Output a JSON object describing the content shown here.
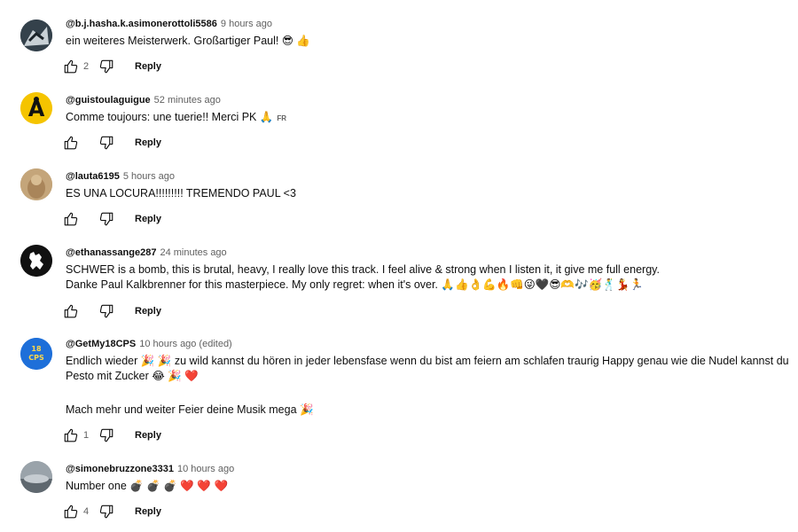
{
  "comments": [
    {
      "author": "@b.j.hasha.k.asimonerottoli5586",
      "time": "9 hours ago",
      "edited": "",
      "text": "ein weiteres Meisterwerk. Großartiger Paul! 😎 👍",
      "lines": [
        "ein weiteres Meisterwerk. Großartiger Paul! 😎 👍"
      ],
      "likes": "2",
      "lang": "",
      "avatar_color": "#3c4a55"
    },
    {
      "author": "@guistoulaguigue",
      "time": "52 minutes ago",
      "edited": "",
      "lines": [
        "Comme toujours: une tuerie!! Merci PK 🙏"
      ],
      "likes": "",
      "lang": "FR",
      "avatar_color": "#f5c400"
    },
    {
      "author": "@lauta6195",
      "time": "5 hours ago",
      "edited": "",
      "lines": [
        "ES UNA LOCURA!!!!!!!!! TREMENDO PAUL  <3"
      ],
      "likes": "",
      "lang": "",
      "avatar_color": "#b89868"
    },
    {
      "author": "@ethanassange287",
      "time": "24 minutes ago",
      "edited": "",
      "lines": [
        "SCHWER is a bomb, this is brutal, heavy, I really love this track. I feel alive & strong when I listen it, it give me full energy.",
        "Danke Paul Kalkbrenner for this masterpiece. My only regret: when it's over. 🙏👍👌💪🔥👊😜🖤😎🫶🎶🥳🕺💃🏃"
      ],
      "likes": "",
      "lang": "",
      "avatar_color": "#111111"
    },
    {
      "author": "@GetMy18CPS",
      "time": "10 hours ago",
      "edited": "(edited)",
      "lines": [
        "Endlich wieder 🎉 🎉 zu wild kannst du hören in jeder lebensfase wenn du bist am feiern am schlafen traurig Happy genau wie die Nudel kannst du",
        "Pesto mit Zucker 😂 🎉 ❤️",
        "",
        "Mach mehr und weiter Feier deine Musik mega 🎉"
      ],
      "likes": "1",
      "lang": "",
      "avatar_color": "#1e6fd9"
    },
    {
      "author": "@simonebruzzone3331",
      "time": "10 hours ago",
      "edited": "",
      "lines": [
        "Number one 💣 💣 💣 ❤️ ❤️ ❤️"
      ],
      "likes": "4",
      "lang": "",
      "avatar_color": "#8a9198"
    }
  ],
  "reply_label": "Reply",
  "avatar_text_getmy": "18\nCPS"
}
